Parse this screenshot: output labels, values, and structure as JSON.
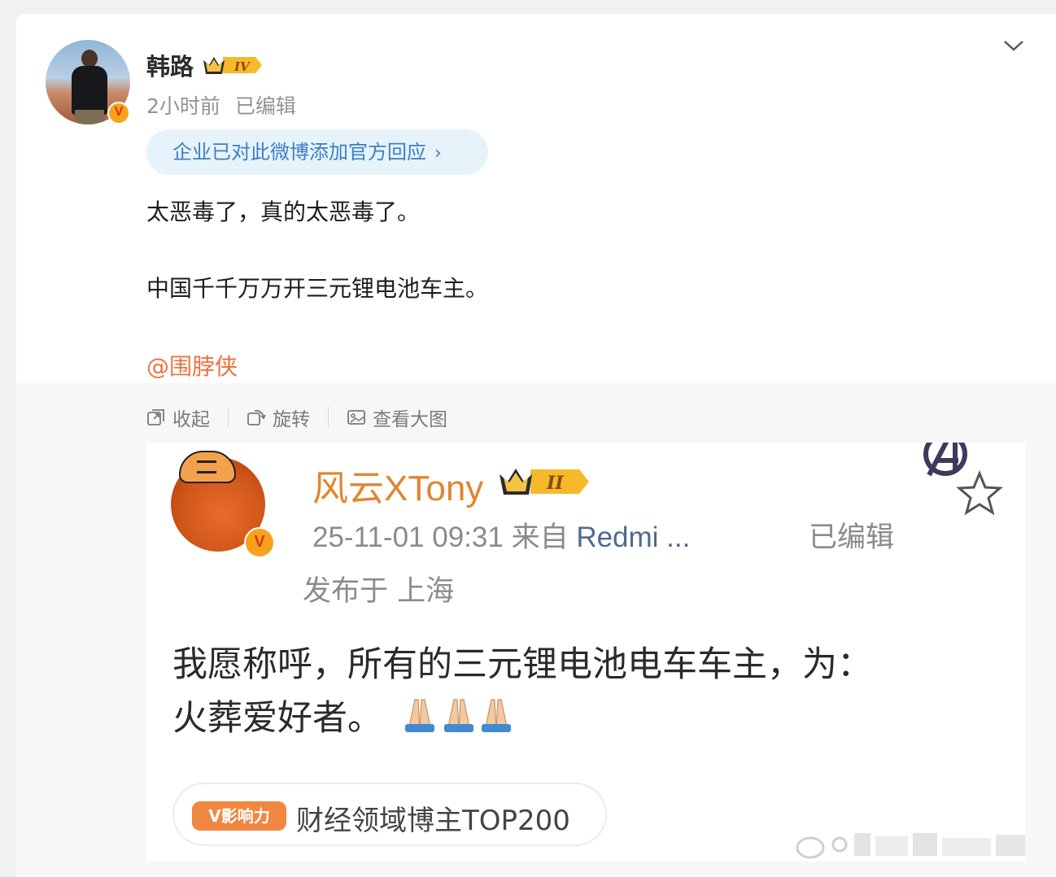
{
  "post": {
    "username": "韩路",
    "level_badge": "IV",
    "time": "2小时前",
    "edited": "已编辑",
    "official_response": "企业已对此微博添加官方回应",
    "official_arrow": "›",
    "text_line1": "太恶毒了，真的太恶毒了。",
    "text_line2": "中国千千万万开三元锂电池车主。",
    "mention": "@围脖侠",
    "verified": "V"
  },
  "toolbar": {
    "collapse": "收起",
    "rotate": "旋转",
    "view_large": "查看大图"
  },
  "screenshot": {
    "name": "风云XTony",
    "level_badge": "II",
    "datetime": "25-11-01 09:31",
    "from_label": "来自",
    "client": "Redmi ...",
    "edited": "已编辑",
    "location": "发布于 上海",
    "text_line1": "我愿称呼，所有的三元锂电池电车车主，为：",
    "text_line2": "火葬爱好者。",
    "influence_label": "V影响力",
    "influence_tag": "财经领域博主TOP200",
    "verified": "V"
  },
  "colors": {
    "accent_orange": "#eb7340",
    "link_blue": "#3d7fc2",
    "badge_gold": "#f6a21b"
  },
  "icons": [
    "chevron-down-icon",
    "collapse-icon",
    "rotate-icon",
    "view-large-icon",
    "star-icon",
    "avengers-logo-icon",
    "prayer-hands-icon"
  ]
}
